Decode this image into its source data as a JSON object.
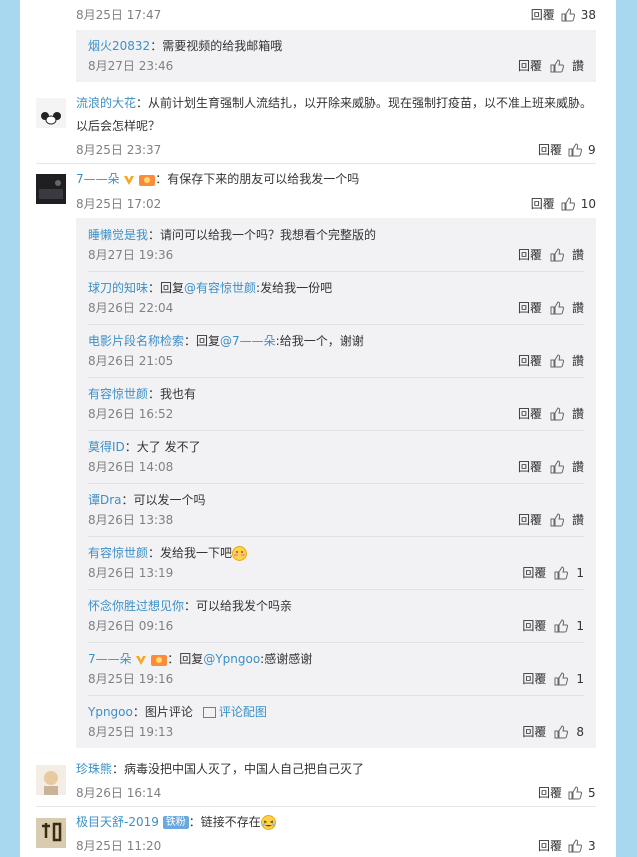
{
  "items": {
    "c0": {
      "time": "8月25日 17:47",
      "reply": "回覆",
      "likes": "38"
    },
    "c0r1": {
      "user": "烟火20832",
      "text": "：需要视频的给我邮箱哦",
      "time": "8月27日 23:46",
      "reply": "回覆",
      "like": "讚"
    },
    "c1": {
      "user": "流浪的大花",
      "text": "：从前计划生育强制人流结扎，以开除来威胁。现在强制打疫苗，以不准上班来威胁。以后会怎样呢？",
      "time": "8月25日 23:37",
      "reply": "回覆",
      "likes": "9"
    },
    "c2": {
      "user": "7——朵",
      "text": "：有保存下来的朋友可以给我发一个吗",
      "time": "8月25日 17:02",
      "reply": "回覆",
      "likes": "10"
    },
    "c2r1": {
      "user": "睡懒觉是我",
      "text": "：请问可以给我一个吗？我想看个完整版的",
      "time": "8月27日 19:36",
      "reply": "回覆",
      "like": "讚"
    },
    "c2r2": {
      "user": "球刀的知味",
      "pre": "：回复",
      "mention": "@有容惊世颜",
      "text": ":发给我一份吧",
      "time": "8月26日 22:04",
      "reply": "回覆",
      "like": "讚"
    },
    "c2r3": {
      "user": "电影片段名称检索",
      "pre": "：回复",
      "mention": "@7——朵",
      "text": ":给我一个，谢谢",
      "time": "8月26日 21:05",
      "reply": "回覆",
      "like": "讚"
    },
    "c2r4": {
      "user": "有容惊世颜",
      "text": "：我也有",
      "time": "8月26日 16:52",
      "reply": "回覆",
      "like": "讚"
    },
    "c2r5": {
      "user": "莫得ID",
      "text": "：大了 发不了",
      "time": "8月26日 14:08",
      "reply": "回覆",
      "like": "讚"
    },
    "c2r6": {
      "user": "谭Dra",
      "text": "：可以发一个吗",
      "time": "8月26日 13:38",
      "reply": "回覆",
      "like": "讚"
    },
    "c2r7": {
      "user": "有容惊世颜",
      "text": "：发给我一下吧",
      "time": "8月26日 13:19",
      "reply": "回覆",
      "likes": "1"
    },
    "c2r8": {
      "user": "怀念你胜过想见你",
      "text": "：可以给我发个吗亲",
      "time": "8月26日 09:16",
      "reply": "回覆",
      "likes": "1"
    },
    "c2r9": {
      "user": "7——朵",
      "pre": "：回复",
      "mention": "@Ypngoo",
      "text": ":感谢感谢",
      "time": "8月25日 19:16",
      "reply": "回覆",
      "likes": "1"
    },
    "c2r10": {
      "user": "Ypngoo",
      "text": "：图片评论",
      "pic": "评论配图",
      "time": "8月25日 19:13",
      "reply": "回覆",
      "likes": "8"
    },
    "c3": {
      "user": "珍珠熊",
      "text": "：病毒没把中国人灭了，中国人自己把自己灭了",
      "time": "8月26日 16:14",
      "reply": "回覆",
      "likes": "5"
    },
    "c4": {
      "user": "极目天舒-2019",
      "badge": "铁粉",
      "text": "：链接不存在",
      "time": "8月25日 11:20",
      "reply": "回覆",
      "likes": "3"
    }
  },
  "colors": {
    "link": "#3c8fc7",
    "meta": "#808080",
    "replyBg": "#f2f2f5",
    "page": "#a8d8f0"
  }
}
